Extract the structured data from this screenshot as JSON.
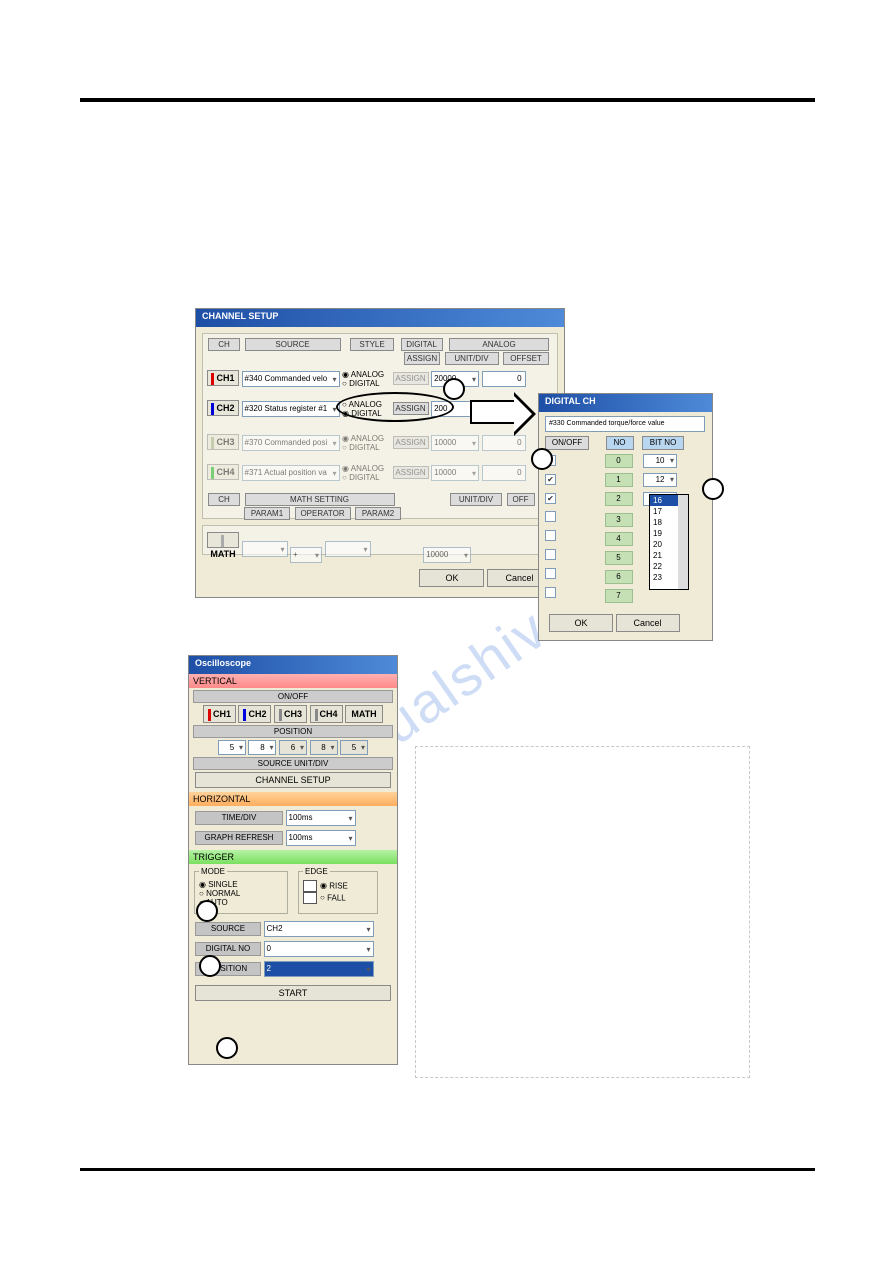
{
  "channel_setup": {
    "title": "CHANNEL SETUP",
    "headers": {
      "ch": "CH",
      "source": "SOURCE",
      "style": "STYLE",
      "digital": "DIGITAL",
      "assign": "ASSIGN",
      "analog": "ANALOG",
      "unitdiv": "UNIT/DIV",
      "offset": "OFFSET"
    },
    "rows": [
      {
        "label": "CH1",
        "source": "#340  Commanded velo",
        "analog": true,
        "assign": "ASSIGN",
        "unitdiv": "20000",
        "offset": "0"
      },
      {
        "label": "CH2",
        "source": "#320  Status register #1",
        "analog": false,
        "assign": "ASSIGN",
        "unitdiv": "200",
        "offset": ""
      },
      {
        "label": "CH3",
        "source": "#370  Commanded posi",
        "analog": true,
        "assign": "ASSIGN",
        "unitdiv": "10000",
        "offset": "0"
      },
      {
        "label": "CH4",
        "source": "#371  Actual position va",
        "analog": true,
        "assign": "ASSIGN",
        "unitdiv": "10000",
        "offset": "0"
      }
    ],
    "radio": {
      "analog": "ANALOG",
      "digital": "DIGITAL"
    },
    "math_section": {
      "ch": "CH",
      "math_setting": "MATH SETTING",
      "unitdiv": "UNIT/DIV",
      "off": "OFF",
      "param1": "PARAM1",
      "operator": "OPERATOR",
      "param2": "PARAM2",
      "label": "MATH",
      "op": "+",
      "val": "10000"
    },
    "ok": "OK",
    "cancel": "Cancel"
  },
  "digital_ch": {
    "title": "DIGITAL CH",
    "sourceField": "#330  Commanded torque/force value",
    "cols": {
      "onoff": "ON/OFF",
      "no": "NO",
      "bitno": "BIT NO"
    },
    "rows": [
      {
        "checked": true,
        "no": "0",
        "bit": "10"
      },
      {
        "checked": true,
        "no": "1",
        "bit": "12"
      },
      {
        "checked": true,
        "no": "2",
        "bit": "16"
      },
      {
        "checked": false,
        "no": "3",
        "bit": ""
      },
      {
        "checked": false,
        "no": "4",
        "bit": ""
      },
      {
        "checked": false,
        "no": "5",
        "bit": ""
      },
      {
        "checked": false,
        "no": "6",
        "bit": ""
      },
      {
        "checked": false,
        "no": "7",
        "bit": ""
      }
    ],
    "list": [
      "16",
      "17",
      "18",
      "19",
      "20",
      "21",
      "22",
      "23"
    ],
    "ok": "OK",
    "cancel": "Cancel"
  },
  "oscilloscope": {
    "title": "Oscilloscope",
    "vertical": {
      "label": "VERTICAL",
      "onoff": "ON/OFF",
      "ch": [
        "CH1",
        "CH2",
        "CH3",
        "CH4",
        "MATH"
      ],
      "position_label": "POSITION",
      "positions": [
        "5",
        "8",
        "6",
        "8",
        "5"
      ],
      "src_unit_div": "SOURCE  UNIT/DIV",
      "channel_setup": "CHANNEL SETUP"
    },
    "horizontal": {
      "label": "HORIZONTAL",
      "timediv_label": "TIME/DIV",
      "timediv": "100ms",
      "refresh_label": "GRAPH REFRESH",
      "refresh": "100ms"
    },
    "trigger": {
      "label": "TRIGGER",
      "mode_label": "MODE",
      "single": "SINGLE",
      "normal": "NORMAL",
      "auto": "AUTO",
      "edge_label": "EDGE",
      "rise": "RISE",
      "fall": "FALL",
      "source_label": "SOURCE",
      "source": "CH2",
      "digno_label": "DIGITAL NO",
      "digno": "0",
      "position_label": "POSITION",
      "position": "2",
      "start": "START"
    }
  },
  "watermark": "manualshive.com"
}
